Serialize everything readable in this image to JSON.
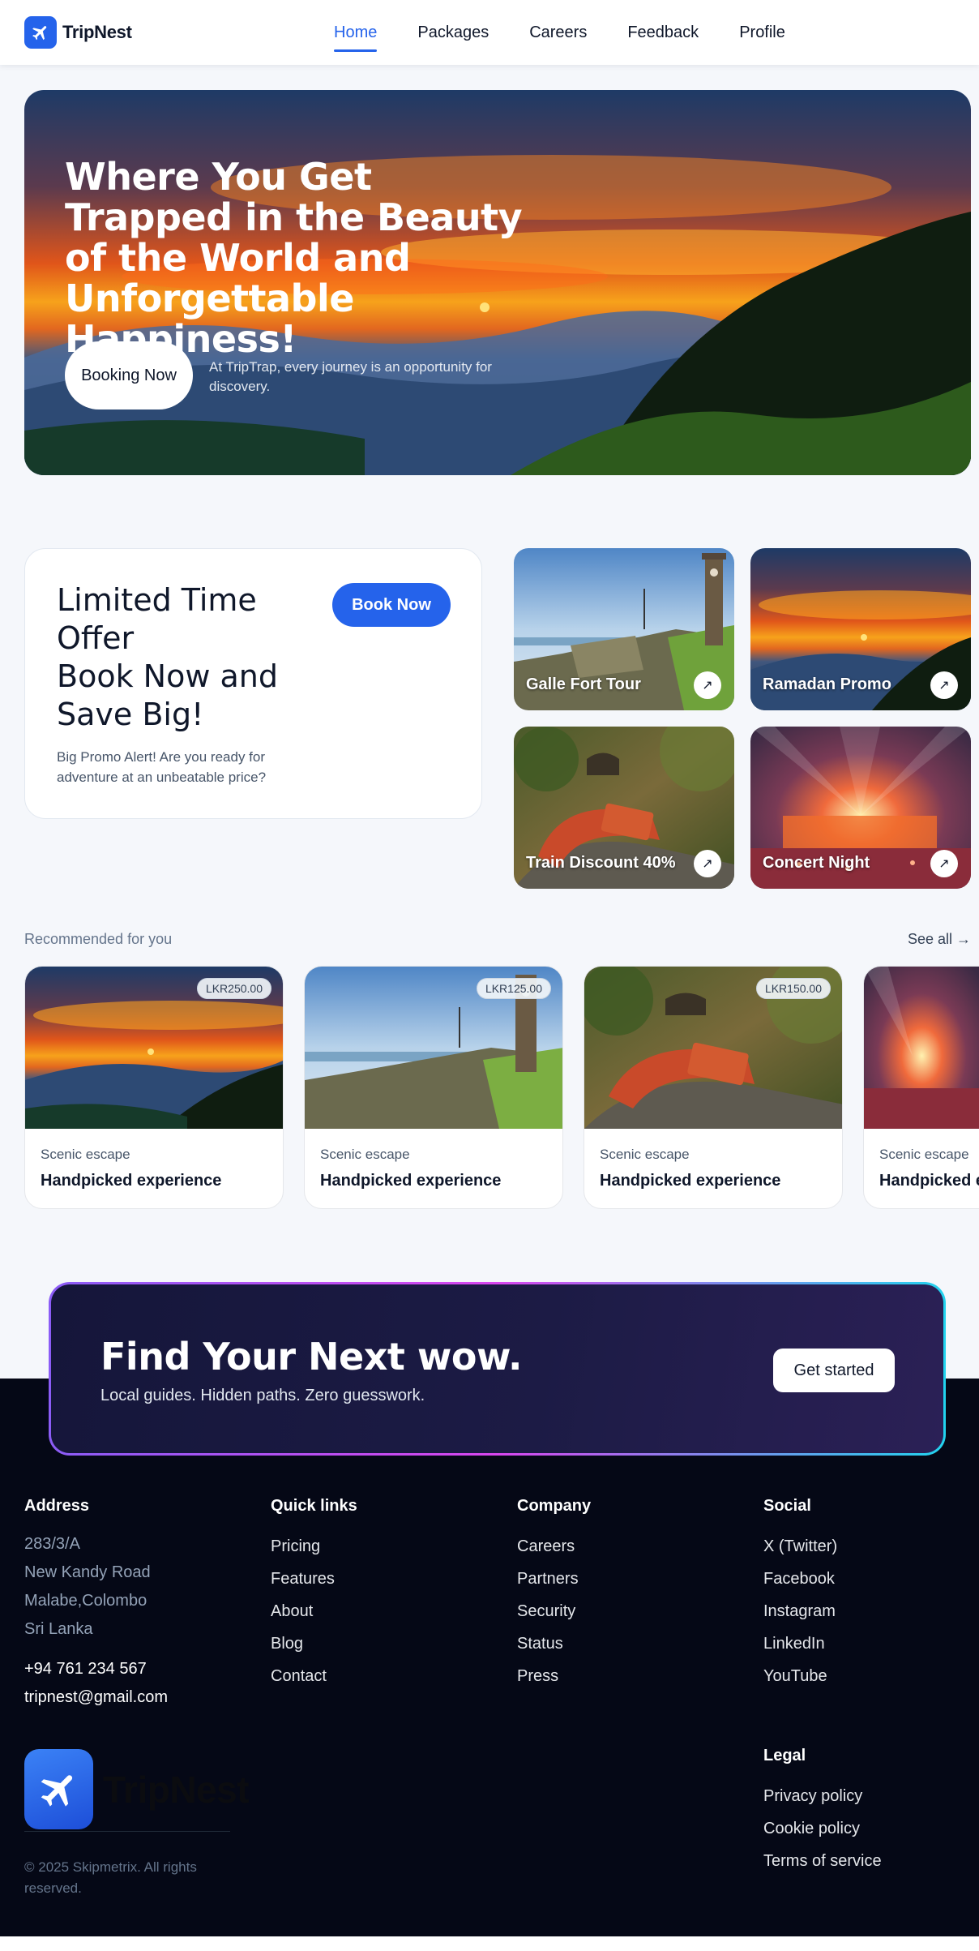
{
  "nav": {
    "brand": "TripNest",
    "links": [
      "Home",
      "Packages",
      "Careers",
      "Feedback",
      "Profile"
    ],
    "active": "Home"
  },
  "hero": {
    "title": "Where You Get Trapped in the Beauty of the World and Unforgettable Happiness!",
    "button": "Booking Now",
    "subtitle": "At TripTrap, every journey is an opportunity for discovery."
  },
  "promo": {
    "title_line1": "Limited Time Offer",
    "title_line2": "Book Now and Save Big!",
    "button": "Book Now",
    "subtitle": "Big Promo Alert! Are you ready for adventure at an unbeatable price?"
  },
  "tiles": [
    {
      "label": "Galle Fort Tour",
      "arrow": "↗",
      "icon": "arrow-up-right-icon"
    },
    {
      "label": "Ramadan Promo",
      "arrow": "↗",
      "icon": "arrow-up-right-icon"
    },
    {
      "label": "Train Discount 40%",
      "arrow": "↗",
      "icon": "arrow-up-right-icon"
    },
    {
      "label": "Concert Night",
      "arrow": "↗",
      "icon": "arrow-up-right-icon"
    }
  ],
  "recommended": {
    "heading": "Recommended for you",
    "see_all": "See all →",
    "cards": [
      {
        "price": "LKR250.00",
        "category": "Scenic escape",
        "title": "Handpicked experience"
      },
      {
        "price": "LKR125.00",
        "category": "Scenic escape",
        "title": "Handpicked experience"
      },
      {
        "price": "LKR150.00",
        "category": "Scenic escape",
        "title": "Handpicked experience"
      },
      {
        "price": "",
        "category": "Scenic escape",
        "title": "Handpicked experience"
      }
    ]
  },
  "cta": {
    "title": "Find Your Next wow.",
    "subtitle": "Local guides. Hidden paths. Zero guesswork.",
    "button": "Get started"
  },
  "footer": {
    "address": {
      "heading": "Address",
      "lines": [
        "283/3/A",
        "New Kandy Road",
        "Malabe,Colombo",
        "Sri Lanka"
      ],
      "phone": "+94 761 234 567",
      "email": "tripnest@gmail.com"
    },
    "quick_links": {
      "heading": "Quick links",
      "items": [
        "Pricing",
        "Features",
        "About",
        "Blog",
        "Contact"
      ]
    },
    "company": {
      "heading": "Company",
      "items": [
        "Careers",
        "Partners",
        "Security",
        "Status",
        "Press"
      ]
    },
    "social": {
      "heading": "Social",
      "items": [
        "X (Twitter)",
        "Facebook",
        "Instagram",
        "LinkedIn",
        "YouTube"
      ]
    },
    "legal": {
      "heading": "Legal",
      "items": [
        "Privacy policy",
        "Cookie policy",
        "Terms of service"
      ]
    },
    "logo_name": "TripNest",
    "copyright": "© 2025 Skipmetrix. All rights reserved."
  },
  "colors": {
    "accent": "#2563eb",
    "footer_bg": "#050816",
    "cta_bg": "#1c1b45"
  }
}
